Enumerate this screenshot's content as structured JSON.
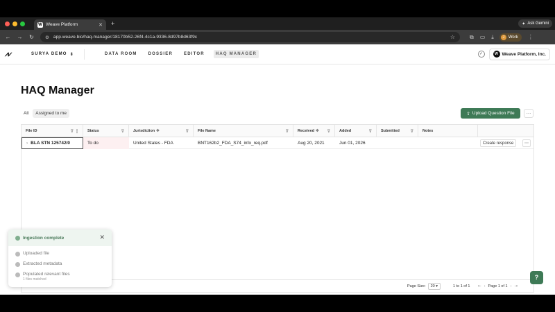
{
  "browser": {
    "tab_title": "Weave Platform",
    "url": "app.weave.bio/haq-manager/18170b52-26f4-4c1a-9336-8d97b8d63f9c",
    "ask_gemini": "Ask Gemini",
    "profile": "Work",
    "profile_initial": "J",
    "dot_colors": [
      "#ff5f57",
      "#febc2e",
      "#28c840"
    ]
  },
  "app": {
    "workspace": "SURYA DEMO",
    "nav": [
      "DATA ROOM",
      "DOSSIER",
      "EDITOR",
      "HAQ MANAGER"
    ],
    "active_nav": "HAQ MANAGER",
    "org": "Weave Platform, Inc."
  },
  "page": {
    "title": "HAQ Manager",
    "filters": [
      "All",
      "Assigned to me"
    ],
    "upload_button": "Upload Question File"
  },
  "table": {
    "columns": [
      "File ID",
      "Status",
      "Jurisdiction",
      "File Name",
      "Received",
      "Added",
      "Submitted",
      "Notes"
    ],
    "rows": [
      {
        "file_id": "BLA STN 125742/0",
        "status": "To do",
        "jurisdiction": "United States - FDA",
        "file_name": "BNT162b2_FDA_S74_info_req.pdf",
        "received": "Aug 20, 2021",
        "added": "Jun 01, 2026",
        "submitted": "",
        "notes": "",
        "action": "Create response"
      }
    ],
    "footer": {
      "page_size_label": "Page Size:",
      "page_size": "20",
      "row_count": "1 to 1 of 1",
      "page_text": "Page 1 of 1"
    }
  },
  "toast": {
    "title": "Ingestion complete",
    "steps": [
      {
        "label": "Uploaded file",
        "sub": ""
      },
      {
        "label": "Extracted metadata",
        "sub": ""
      },
      {
        "label": "Populated relevant files",
        "sub": "1 files matched"
      }
    ]
  },
  "colors": {
    "brand_green": "#3e7a56",
    "status_bg": "#fdf0f1"
  }
}
